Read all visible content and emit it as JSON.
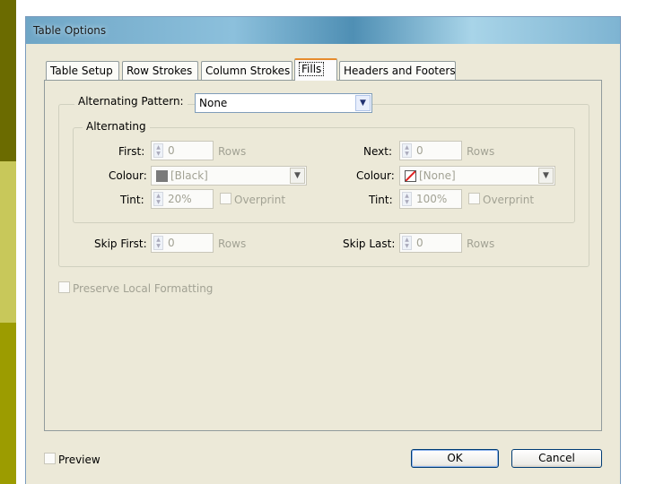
{
  "window": {
    "title": "Table Options"
  },
  "tabs": [
    {
      "label": "Table Setup"
    },
    {
      "label": "Row Strokes"
    },
    {
      "label": "Column Strokes"
    },
    {
      "label": "Fills"
    },
    {
      "label": "Headers and Footers"
    }
  ],
  "active_tab": "Fills",
  "alternating_pattern": {
    "label": "Alternating Pattern:",
    "value": "None"
  },
  "alternating_group": {
    "legend": "Alternating",
    "first": {
      "label": "First:",
      "value": "0",
      "unit": "Rows"
    },
    "next": {
      "label": "Next:",
      "value": "0",
      "unit": "Rows"
    },
    "colour_left": {
      "label": "Colour:",
      "value": "[Black]"
    },
    "colour_right": {
      "label": "Colour:",
      "value": "[None]"
    },
    "tint_left": {
      "label": "Tint:",
      "value": "20%",
      "overprint": "Overprint"
    },
    "tint_right": {
      "label": "Tint:",
      "value": "100%",
      "overprint": "Overprint"
    }
  },
  "skip_first": {
    "label": "Skip First:",
    "value": "0",
    "unit": "Rows"
  },
  "skip_last": {
    "label": "Skip Last:",
    "value": "0",
    "unit": "Rows"
  },
  "preserve_local_formatting": "Preserve Local Formatting",
  "preview": "Preview",
  "buttons": {
    "ok": "OK",
    "cancel": "Cancel"
  },
  "colors": {
    "dialog_bg": "#ece9d8",
    "active_tab_accent": "#e68b2c",
    "disabled_text": "#a2a294"
  }
}
